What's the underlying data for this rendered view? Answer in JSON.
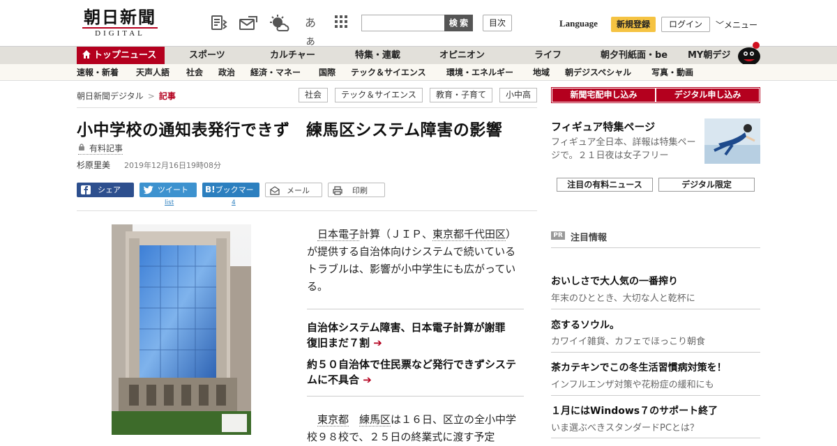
{
  "header": {
    "logo_kanji": "朝日新聞",
    "logo_sub": "DIGITAL",
    "font_size_icon_label": "あぁ",
    "search_placeholder": "",
    "search_button": "検 索",
    "toc_button": "目次",
    "language": "Language",
    "register": "新規登録",
    "login": "ログイン",
    "menu": "メニュー"
  },
  "mainnav": [
    "トップニュース",
    "スポーツ",
    "カルチャー",
    "特集・連載",
    "オピニオン",
    "ライフ",
    "朝夕刊紙面・be",
    "MY朝デジ"
  ],
  "subnav": [
    "速報・新着",
    "天声人語",
    "社会",
    "政治",
    "経済・マネー",
    "国際",
    "テック＆サイエンス",
    "環境・エネルギー",
    "地域",
    "朝デジスペシャル",
    "写真・動画"
  ],
  "breadcrumb": {
    "home": "朝日新聞デジタル",
    "sep": ">",
    "current": "記事"
  },
  "tags": [
    "社会",
    "テック＆サイエンス",
    "教育・子育て",
    "小中高"
  ],
  "article": {
    "title": "小中学校の通知表発行できず　練馬区システム障害の影響",
    "paid": "有料記事",
    "author": "杉原里美",
    "date": "2019年12月16日19時08分",
    "lead_a": "日本電子",
    "lead_b": "計算（ＪＩＰ、",
    "lead_c": "東京都千代田区",
    "lead_d": "）が提供する自治体向けシステムで続いているトラブルは、影響が小中学生にも広がっている。",
    "related": [
      "自治体システム障害、日本電子計算が謝罪　復旧まだ７割",
      "約５０自治体で住民票など発行できずシステムに不具合"
    ],
    "body_a": "東京都",
    "body_b": "練馬区",
    "body_c": "は１６日、区立の全小中学校９８校で、２５日の終業式に渡す予定"
  },
  "share": {
    "facebook": "シェア",
    "twitter": "ツイート",
    "twitter_count": "list",
    "hatena": "ブックマーク",
    "hatena_count": "4",
    "mail": "メール",
    "print": "印刷"
  },
  "sidebar": {
    "apply_newspaper": "新聞宅配申し込み",
    "apply_digital": "デジタル申し込み",
    "feature_title": "フィギュア特集ページ",
    "feature_desc": "フィギュア全日本、詳報は特集ページで。２１日夜は女子フリー",
    "btn_paid_news": "注目の有料ニュース",
    "btn_digital_only": "デジタル限定",
    "pr_badge": "PR",
    "pr_title": "注目情報",
    "ads": [
      {
        "title": "おいしさで大人気の一番搾り",
        "desc": "年末のひととき、大切な人と乾杯に"
      },
      {
        "title": "恋するソウル。",
        "desc": "カワイイ雑貨、カフェでほっこり朝食"
      },
      {
        "title": "茶カテキンでこの冬生活習慣病対策を！",
        "desc": "インフルエンザ対策や花粉症の緩和にも"
      },
      {
        "title": "１月にはWindows７のサポート終了",
        "desc": "いま選ぶべきスタンダードPCとは？"
      }
    ]
  },
  "colors": {
    "brand_red": "#b4001e",
    "register_yellow": "#f5c342",
    "nav_gray": "#e2e0da"
  }
}
